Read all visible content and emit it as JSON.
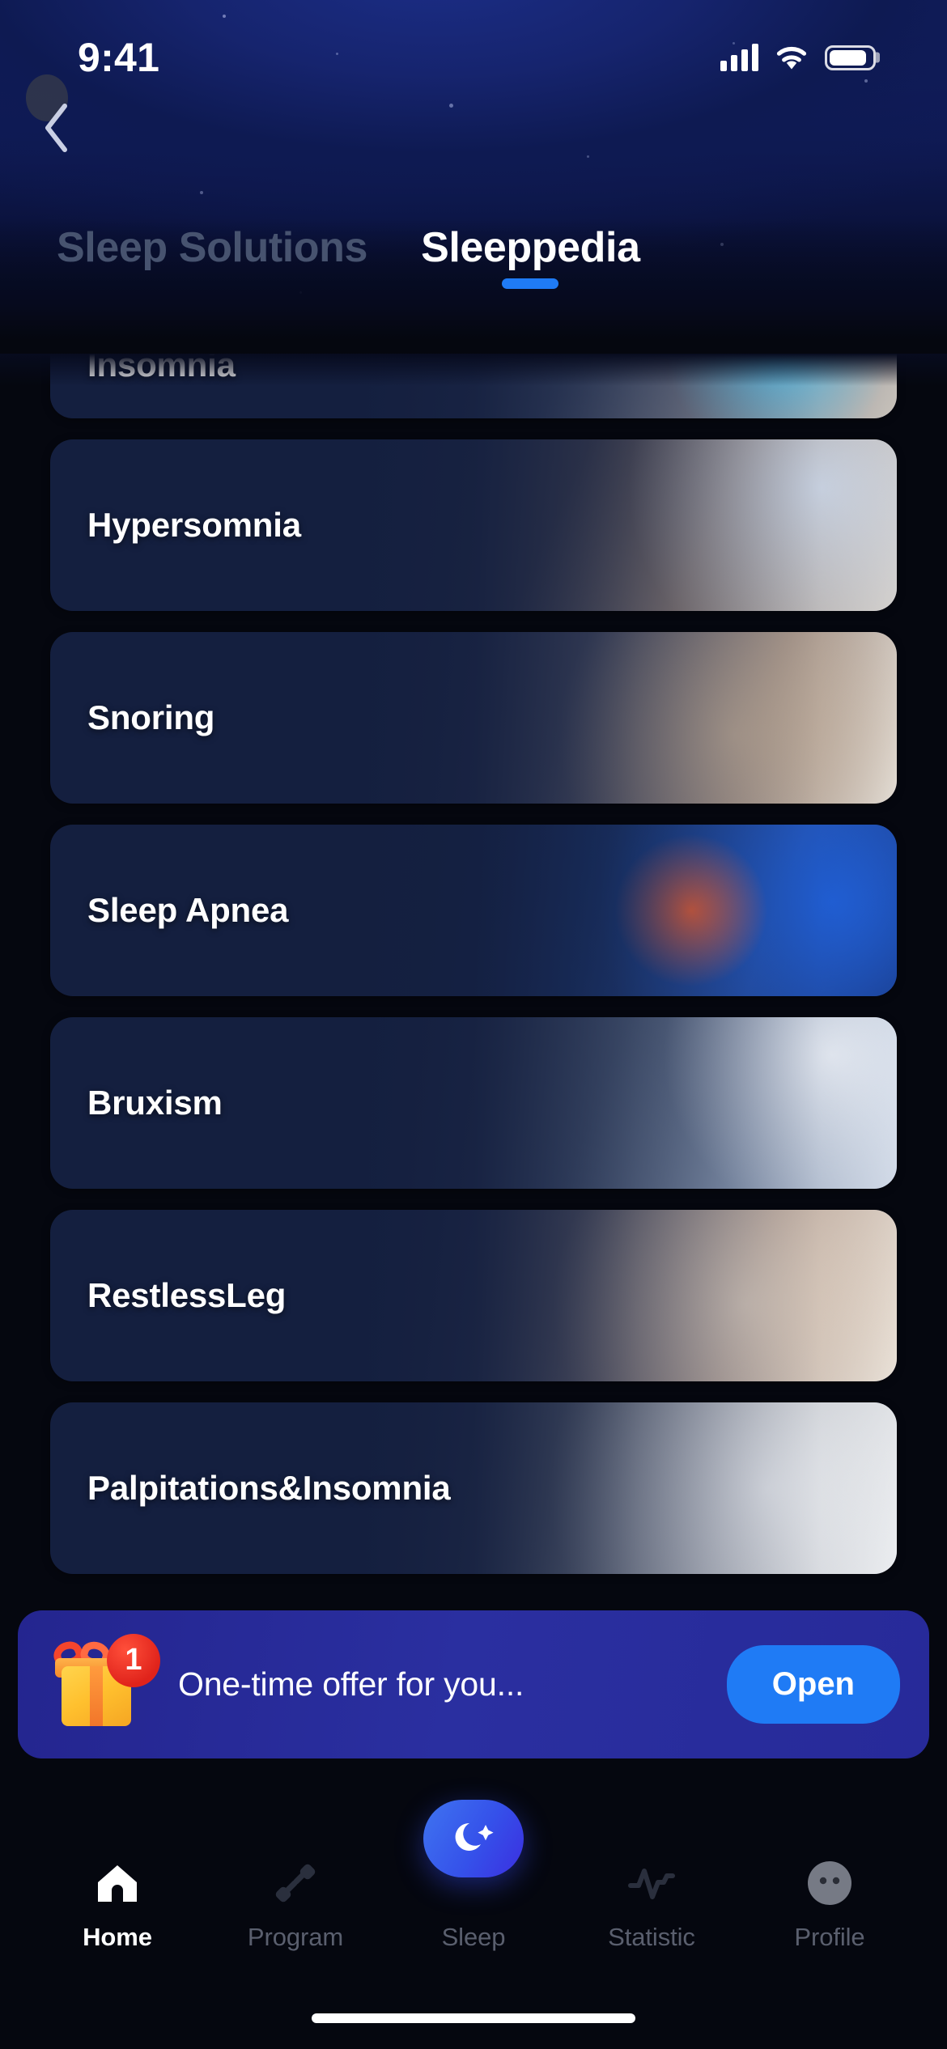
{
  "status_bar": {
    "time": "9:41",
    "cellular_icon": "cellular-signal-icon",
    "wifi_icon": "wifi-icon",
    "battery_icon": "battery-icon"
  },
  "header": {
    "back_icon": "chevron-left-icon",
    "tabs": [
      {
        "label": "Sleep Solutions",
        "active": false
      },
      {
        "label": "Sleeppedia",
        "active": true
      }
    ],
    "active_indicator_color": "#1f7bf5"
  },
  "list": {
    "items": [
      {
        "label": "Insomnia",
        "photo": "ph-insomnia"
      },
      {
        "label": "Hypersomnia",
        "photo": "ph-hyper"
      },
      {
        "label": "Snoring",
        "photo": "ph-snoring"
      },
      {
        "label": "Sleep Apnea",
        "photo": "ph-apnea"
      },
      {
        "label": "Bruxism",
        "photo": "ph-bruxism"
      },
      {
        "label": "RestlessLeg",
        "photo": "ph-restless"
      },
      {
        "label": "Palpitations&Insomnia",
        "photo": "ph-palp"
      }
    ]
  },
  "promo": {
    "gift_icon": "gift-box-icon",
    "badge_count": "1",
    "text": "One-time offer for you...",
    "button_label": "Open",
    "button_color": "#1f7bf5",
    "background_color": "#272a99"
  },
  "bottom_nav": {
    "items": [
      {
        "label": "Home",
        "icon": "home-icon",
        "active": true
      },
      {
        "label": "Program",
        "icon": "dumbbell-icon",
        "active": false
      },
      {
        "label": "Sleep",
        "icon": "moon-icon",
        "active": false
      },
      {
        "label": "Statistic",
        "icon": "pulse-icon",
        "active": false
      },
      {
        "label": "Profile",
        "icon": "avatar-icon",
        "active": false
      }
    ],
    "accent_color": "#3551ea"
  }
}
